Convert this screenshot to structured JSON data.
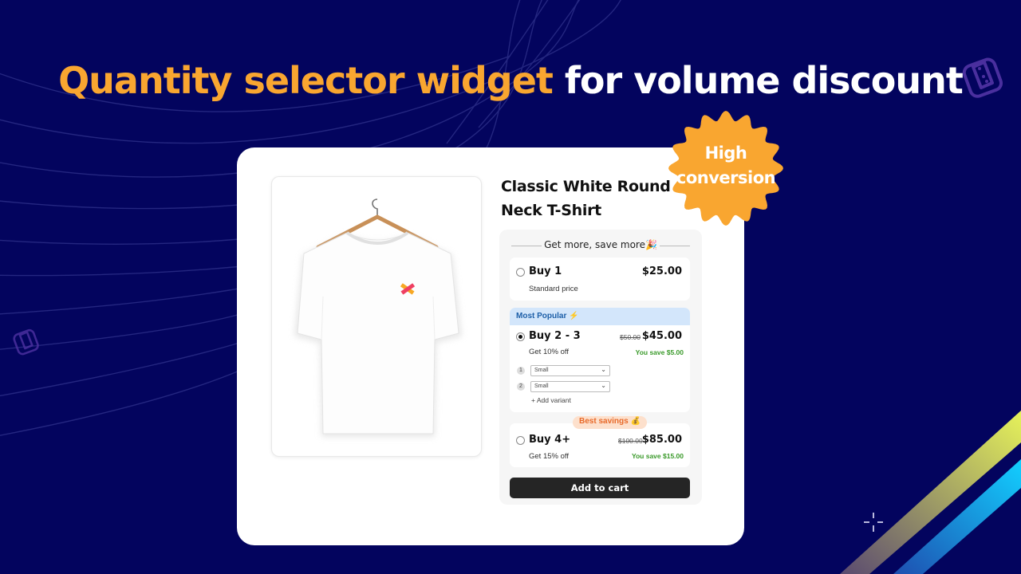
{
  "headline": {
    "highlight": "Quantity selector widget",
    "rest": " for volume discount"
  },
  "colors": {
    "background": "#03045e",
    "accent": "#f9a630",
    "popular_bar": "#d3e6fb",
    "save_green": "#3a9a2a",
    "best_savings": "#e86a2a",
    "cart_button": "#252525"
  },
  "badge": {
    "line1": "High",
    "line2": "conversion"
  },
  "product": {
    "title": "Classic White Round Neck T-Shirt",
    "image_alt": "White t-shirt on wooden hanger"
  },
  "widget": {
    "header": "Get more, save more🎉",
    "options": [
      {
        "label": "Buy 1",
        "subtitle": "Standard price",
        "price": "$25.00",
        "selected": false
      },
      {
        "tag": "Most Popular ⚡",
        "label": "Buy 2 - 3",
        "subtitle": "Get 10% off",
        "original_price": "$50.00",
        "price": "$45.00",
        "savings": "You save $5.00",
        "selected": true,
        "variants": [
          {
            "index": "1",
            "value": "Small"
          },
          {
            "index": "2",
            "value": "Small"
          }
        ],
        "add_variant": "+ Add variant"
      },
      {
        "tag": "Best savings 💰",
        "label": "Buy 4+",
        "subtitle": "Get 15% off",
        "original_price": "$100.00",
        "price": "$85.00",
        "savings": "You save $15.00",
        "selected": false
      }
    ],
    "cart_button": "Add to cart"
  },
  "icons": {
    "top_right": "discount-tag-icon",
    "left": "discount-tag-icon",
    "bottom_right": "sparkle-icon"
  }
}
